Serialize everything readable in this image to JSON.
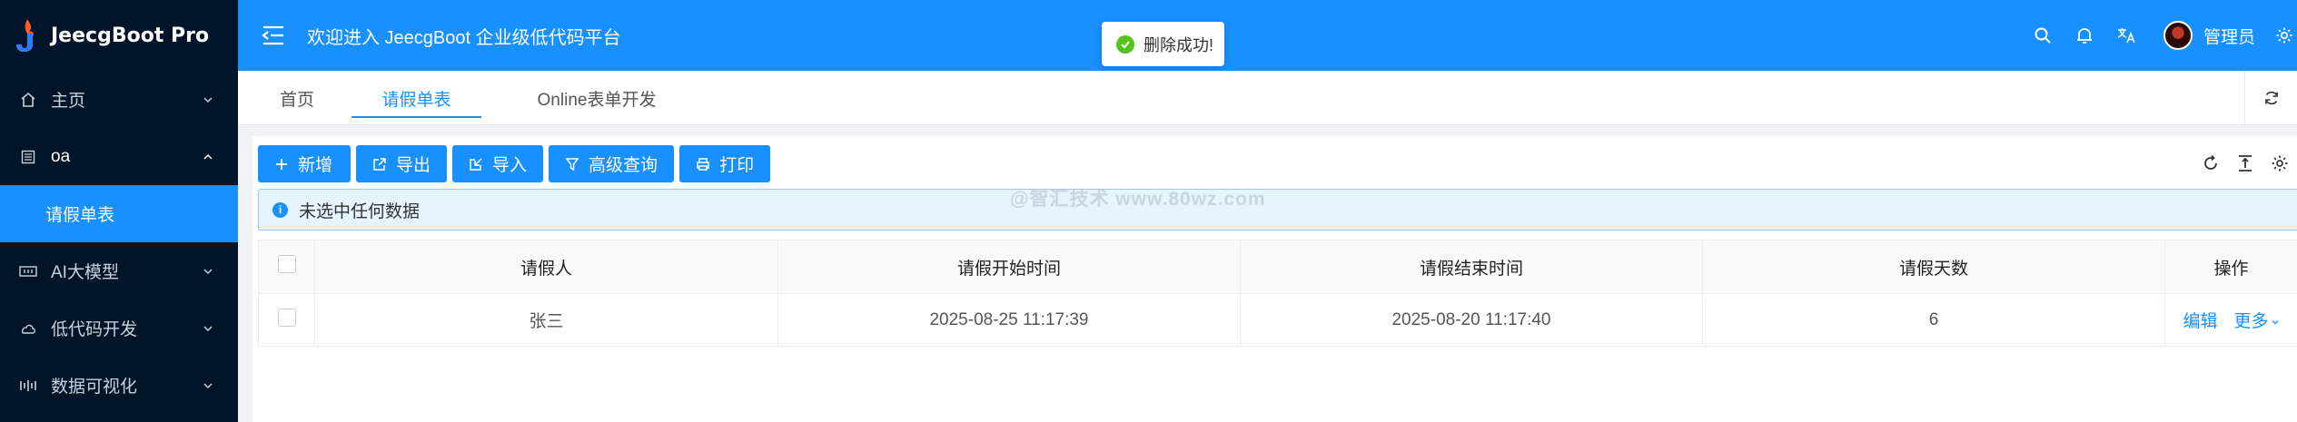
{
  "app": {
    "title": "JeecgBoot Pro"
  },
  "sidebar": {
    "items": [
      {
        "label": "主页",
        "icon": "home-icon"
      },
      {
        "label": "oa",
        "icon": "grid-icon",
        "open": true,
        "children": [
          {
            "label": "请假单表",
            "active": true
          }
        ]
      },
      {
        "label": "AI大模型",
        "icon": "ai-icon"
      },
      {
        "label": "低代码开发",
        "icon": "cloud-icon"
      },
      {
        "label": "数据可视化",
        "icon": "chart-icon"
      }
    ]
  },
  "header": {
    "welcome": "欢迎进入 JeecgBoot 企业级低代码平台",
    "user": "管理员"
  },
  "toast": {
    "message": "删除成功!"
  },
  "tabs": [
    {
      "label": "首页"
    },
    {
      "label": "请假单表",
      "active": true
    },
    {
      "label": "Online表单开发"
    }
  ],
  "toolbar": {
    "add": "新增",
    "export": "导出",
    "import": "导入",
    "advanced_query": "高级查询",
    "print": "打印"
  },
  "alert": {
    "text": "未选中任何数据"
  },
  "watermark": "@智汇技术 www.80wz.com",
  "table": {
    "columns": [
      "请假人",
      "请假开始时间",
      "请假结束时间",
      "请假天数",
      "操作"
    ],
    "rows": [
      {
        "name": "张三",
        "start": "2025-08-25 11:17:39",
        "end": "2025-08-20 11:17:40",
        "days": "6",
        "edit": "编辑",
        "more": "更多"
      }
    ]
  },
  "colors": {
    "primary": "#1890ff",
    "sidebar_bg": "#001529",
    "success": "#52c41a"
  }
}
